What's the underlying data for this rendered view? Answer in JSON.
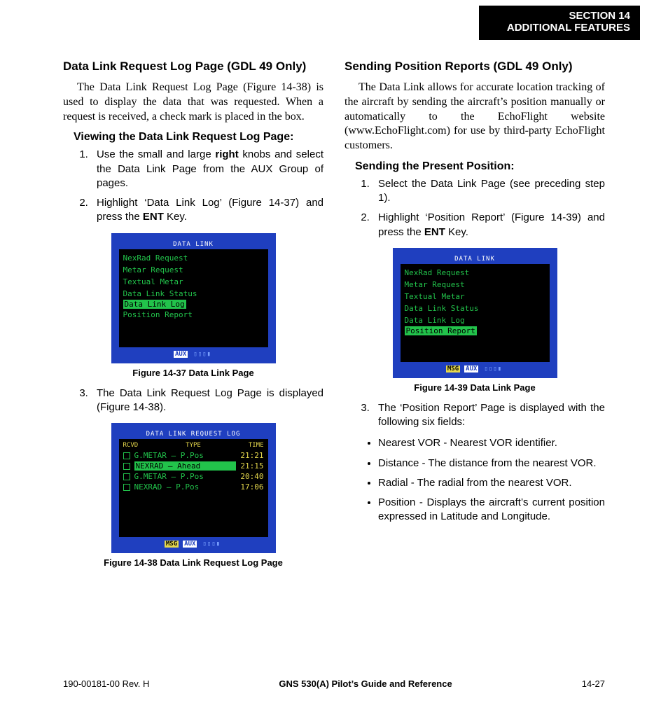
{
  "header": {
    "line1": "SECTION 14",
    "line2": "ADDITIONAL FEATURES"
  },
  "left": {
    "h2": "Data Link Request Log Page (GDL 49 Only)",
    "intro": "The Data Link Request Log Page (Figure 14-38) is used to display the data that was requested.  When a request is received, a check mark is placed in the box.",
    "h3": "Viewing the Data Link Request Log Page:",
    "step1_a": "Use the small and large ",
    "step1_b": "right",
    "step1_c": " knobs and select the Data Link Page from the AUX Group of pages.",
    "step2_a": "Highlight ‘Data Link Log’ (Figure 14-37) and press the ",
    "step2_b": "ENT",
    "step2_c": " Key.",
    "fig37": {
      "title": "DATA LINK",
      "items": [
        "NexRad Request",
        "Metar Request",
        "Textual Metar",
        "Data Link Status",
        "Data Link Log",
        "Position Report"
      ],
      "selected": "Data Link Log",
      "aux": "AUX",
      "bars": "▯▯▯▮",
      "caption": "Figure 14-37  Data Link Page"
    },
    "step3": "The Data Link Request Log Page is displayed (Figure 14-38).",
    "fig38": {
      "title": "DATA LINK REQUEST LOG",
      "hdr_rcvd": "RCVD",
      "hdr_type": "TYPE",
      "hdr_time": "TIME",
      "rows": [
        {
          "type": "G.METAR – P.Pos",
          "time": "21:21"
        },
        {
          "type": "NEXRAD – Ahead",
          "time": "21:15",
          "sel": true
        },
        {
          "type": "G.METAR – P.Pos",
          "time": "20:40"
        },
        {
          "type": "NEXRAD – P.Pos",
          "time": "17:06"
        }
      ],
      "msg": "MSG",
      "aux": "AUX",
      "bars": "▯▯▯▮",
      "caption": "Figure 14-38  Data Link Request Log Page"
    }
  },
  "right": {
    "h2": "Sending Position Reports (GDL 49 Only)",
    "intro": "The Data Link allows for accurate location tracking of the aircraft by sending the aircraft’s position manually or automatically to the EchoFlight website (www.EchoFlight.com) for use by third-party EchoFlight customers.",
    "h3": "Sending the Present Position:",
    "step1": "Select the Data Link Page (see preceding step 1).",
    "step2_a": "Highlight ‘Position Report’ (Figure 14-39) and press the ",
    "step2_b": "ENT",
    "step2_c": " Key.",
    "fig39": {
      "title": "DATA LINK",
      "items": [
        "NexRad Request",
        "Metar Request",
        "Textual Metar",
        "Data Link Status",
        "Data Link Log",
        "Position Report"
      ],
      "selected": "Position Report",
      "msg": "MSG",
      "aux": "AUX",
      "bars": "▯▯▯▮",
      "caption": "Figure 14-39  Data Link Page"
    },
    "step3": "The ‘Position Report’ Page is displayed with the following six fields:",
    "bullets": [
      "Nearest VOR - Nearest VOR identifier.",
      "Distance - The distance from the nearest VOR.",
      "Radial - The radial from the nearest VOR.",
      "Position - Displays the aircraft’s current position expressed in Latitude and Longitude."
    ]
  },
  "footer": {
    "left": "190-00181-00  Rev. H",
    "center": "GNS 530(A) Pilot’s Guide and Reference",
    "right": "14-27"
  }
}
